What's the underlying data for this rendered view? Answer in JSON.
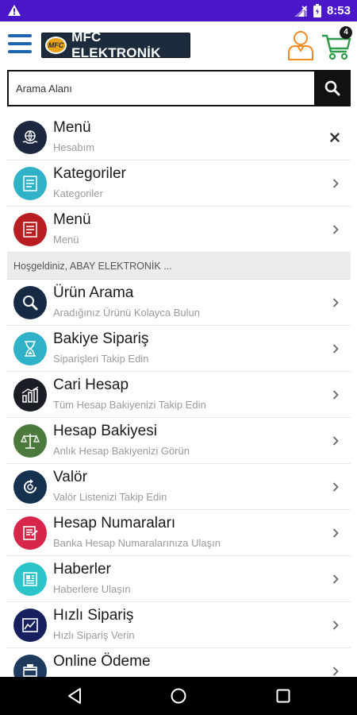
{
  "status_bar": {
    "time": "8:53",
    "warning_icon": "warning-triangle-icon"
  },
  "header": {
    "logo_text": "MFC ELEKTRONİK",
    "logo_badge": "MFC",
    "cart_count": "4"
  },
  "search": {
    "placeholder": "Arama Alanı"
  },
  "top_items": [
    {
      "title": "Menü",
      "subtitle": "Hesabım",
      "icon": "globe-hands-icon",
      "color": "#1b2840",
      "action": "close"
    },
    {
      "title": "Kategoriler",
      "subtitle": "Kategoriler",
      "icon": "list-icon",
      "color": "#2fb2c8",
      "action": "chevron"
    },
    {
      "title": "Menü",
      "subtitle": "Menü",
      "icon": "list-icon",
      "color": "#b81d22",
      "action": "chevron"
    }
  ],
  "welcome": "Hoşgeldiniz, ABAY ELEKTRONİK ...",
  "items": [
    {
      "title": "Ürün Arama",
      "subtitle": "Aradığınız Ürünü Kolayca Bulun",
      "icon": "magnifier-icon",
      "color": "#172a44"
    },
    {
      "title": "Bakiye Sipariş",
      "subtitle": "Siparişleri Takip Edin",
      "icon": "hourglass-icon",
      "color": "#2fb2c8"
    },
    {
      "title": "Cari Hesap",
      "subtitle": "Tüm Hesap Bakiyenizi Takip Edin",
      "icon": "bar-chart-icon",
      "color": "#1a1d24"
    },
    {
      "title": "Hesap Bakiyesi",
      "subtitle": "Anlık Hesap Bakiyenizi Görün",
      "icon": "scales-icon",
      "color": "#4c7a3d"
    },
    {
      "title": "Valör",
      "subtitle": "Valör Listenizi Takip Edin",
      "icon": "refresh-icon",
      "color": "#15314f"
    },
    {
      "title": "Hesap Numaraları",
      "subtitle": "Banka Hesap Numaralarınıza Ulaşın",
      "icon": "document-icon",
      "color": "#d8264a"
    },
    {
      "title": "Haberler",
      "subtitle": "Haberlere Ulaşın",
      "icon": "newspaper-icon",
      "color": "#2bc5c9"
    },
    {
      "title": "Hızlı Sipariş",
      "subtitle": "Hızlı Sipariş Verin",
      "icon": "chart-line-icon",
      "color": "#17205e"
    },
    {
      "title": "Online Ödeme",
      "subtitle": "",
      "icon": "payment-icon",
      "color": "#1f3a5f"
    }
  ],
  "colors": {
    "status_bar": "#4b18c9",
    "hamburger": "#1f64b0",
    "user_icon": "#f08a24",
    "cart_icon": "#2e9b4a"
  }
}
